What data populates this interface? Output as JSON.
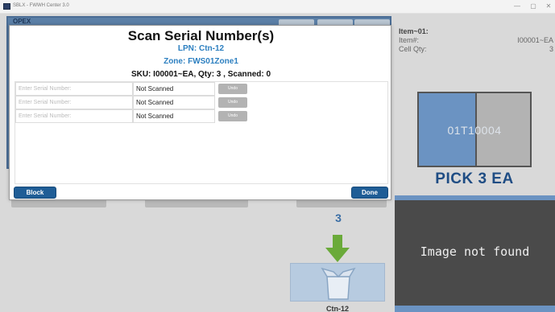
{
  "window": {
    "title": "SBLX - FWWH Center 3.0",
    "controls": [
      "—",
      "▢",
      "✕"
    ]
  },
  "background": {
    "header_label": "OPEX",
    "info_panel": {
      "rows": [
        {
          "label": "Item~01:",
          "value": ""
        },
        {
          "label": "Item#:",
          "value": "I00001~EA"
        },
        {
          "label": "Cell Qty:",
          "value": "3"
        }
      ]
    },
    "pick_location": "01T10004",
    "pick_instruction": "PICK 3 EA",
    "image_message": "Image not found",
    "quantity": "3",
    "carton_label": "Ctn-12",
    "colors": {
      "accent_blue": "#6b93c2",
      "label_blue": "#1f4d84",
      "arrow_green": "#6aaa3a"
    }
  },
  "modal": {
    "title": "Scan Serial Number(s)",
    "lpn": "LPN: Ctn-12",
    "zone": "Zone: FWS01Zone1",
    "sku_line": "SKU: I00001~EA, Qty: 3 , Scanned: 0",
    "serial_rows": [
      {
        "placeholder": "Enter Serial Number:",
        "status": "Not Scanned",
        "undo_label": "Undo"
      },
      {
        "placeholder": "Enter Serial Number:",
        "status": "Not Scanned",
        "undo_label": "Undo"
      },
      {
        "placeholder": "Enter Serial Number:",
        "status": "Not Scanned",
        "undo_label": "Undo"
      }
    ],
    "block_button": "Block",
    "done_button": "Done",
    "colors": {
      "button_blue": "#1f5d96",
      "sub_text_blue": "#2c7fc0"
    }
  }
}
